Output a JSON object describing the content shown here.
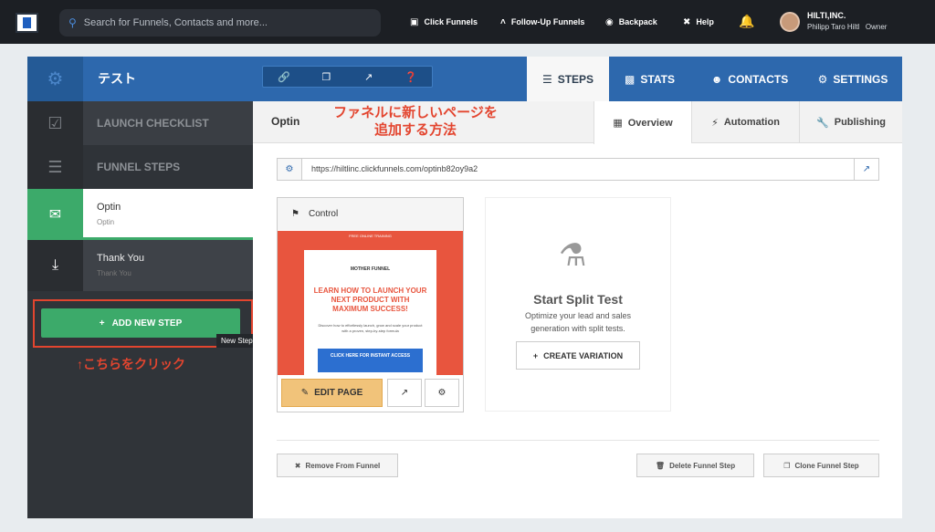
{
  "topbar": {
    "search_placeholder": "Search for Funnels, Contacts and more...",
    "nav": [
      {
        "label": "Click Funnels",
        "icon": "clickfunnels-icon"
      },
      {
        "label": "Follow-Up Funnels",
        "icon": "followup-icon"
      },
      {
        "label": "Backpack",
        "icon": "backpack-icon"
      },
      {
        "label": "Help",
        "icon": "help-icon"
      }
    ],
    "user": {
      "company": "HILTI,INC.",
      "name": "Philipp Taro Hiltl",
      "role": "Owner"
    }
  },
  "funnel": {
    "name": "テスト",
    "tabs": [
      {
        "label": "STEPS",
        "icon": "list-icon"
      },
      {
        "label": "STATS",
        "icon": "bar-chart-icon"
      },
      {
        "label": "CONTACTS",
        "icon": "users-icon"
      },
      {
        "label": "SETTINGS",
        "icon": "gear-icon"
      }
    ]
  },
  "sidebar": {
    "launch_checklist": "LAUNCH CHECKLIST",
    "funnel_steps": "FUNNEL STEPS",
    "steps": [
      {
        "title": "Optin",
        "subtitle": "Optin"
      },
      {
        "title": "Thank You",
        "subtitle": "Thank You"
      }
    ],
    "add_button": "ADD NEW STEP",
    "tooltip": "New Step In Funnel"
  },
  "annotations": {
    "title_line1": "ファネルに新しいページを",
    "title_line2": "追加する方法",
    "click_here": "↑こちらをクリック"
  },
  "step": {
    "title": "Optin",
    "subtabs": [
      {
        "label": "Overview",
        "icon": "grid-icon"
      },
      {
        "label": "Automation",
        "icon": "bolt-icon"
      },
      {
        "label": "Publishing",
        "icon": "wrench-icon"
      }
    ],
    "url": "https://hiltlinc.clickfunnels.com/optinb82oy9a2",
    "control_label": "Control",
    "preview": {
      "top": "FREE ONLINE TRAINING",
      "logo": "MOTHER FUNNEL",
      "headline": "LEARN HOW TO LAUNCH YOUR NEXT PRODUCT WITH MAXIMUM SUCCESS!",
      "body": "Discover how to effortlessly launch, grow and scale your product with a proven, step-by-step formula",
      "cta": "CLICK HERE FOR INSTANT ACCESS"
    },
    "edit_page": "EDIT PAGE",
    "split": {
      "title": "Start Split Test",
      "desc": "Optimize your lead and sales generation with split tests.",
      "button": "CREATE VARIATION"
    },
    "footer": {
      "remove": "Remove From Funnel",
      "delete": "Delete Funnel Step",
      "clone": "Clone Funnel Step"
    }
  },
  "colors": {
    "primary": "#2d68ad",
    "green": "#3caa6a",
    "annotation": "#e3452f",
    "edit": "#f1c37a"
  }
}
